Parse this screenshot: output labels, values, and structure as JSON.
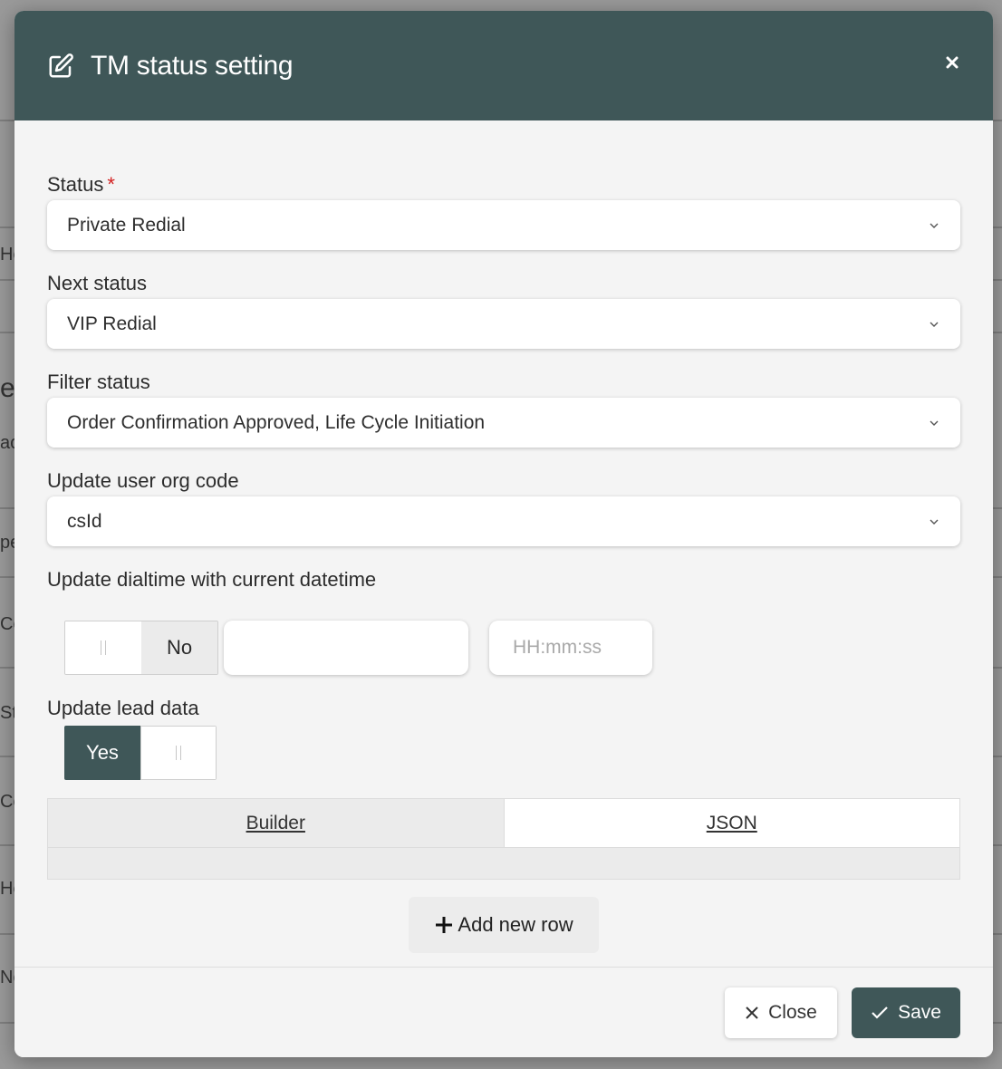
{
  "background": {
    "snippets": [
      "He",
      "e",
      "ac",
      "pe",
      "Co",
      "St",
      "Co",
      "He",
      "No"
    ]
  },
  "modal": {
    "title": "TM status setting",
    "header_icon": "edit-icon",
    "close_icon": "close-icon"
  },
  "form": {
    "status": {
      "label": "Status",
      "required_mark": "*",
      "value": "Private Redial"
    },
    "next_status": {
      "label": "Next status",
      "value": "VIP Redial"
    },
    "filter_status": {
      "label": "Filter status",
      "value": "Order Confirmation Approved, Life Cycle Initiation"
    },
    "update_user_org_code": {
      "label": "Update user org code",
      "value": "csId"
    },
    "update_dialtime": {
      "label": "Update dialtime with current datetime",
      "toggle_label": "No",
      "date_value": "",
      "time_placeholder": "HH:mm:ss"
    },
    "update_lead_data": {
      "label": "Update lead data",
      "toggle_label": "Yes"
    },
    "tabs": [
      {
        "label": "Builder",
        "active": false
      },
      {
        "label": "JSON",
        "active": true
      }
    ],
    "add_row_label": "Add new row"
  },
  "footer": {
    "close_label": "Close",
    "save_label": "Save"
  },
  "colors": {
    "header_bg": "#3f5758",
    "primary": "#3f5758",
    "required": "#d32020",
    "modal_bg": "#f4f4f4"
  }
}
